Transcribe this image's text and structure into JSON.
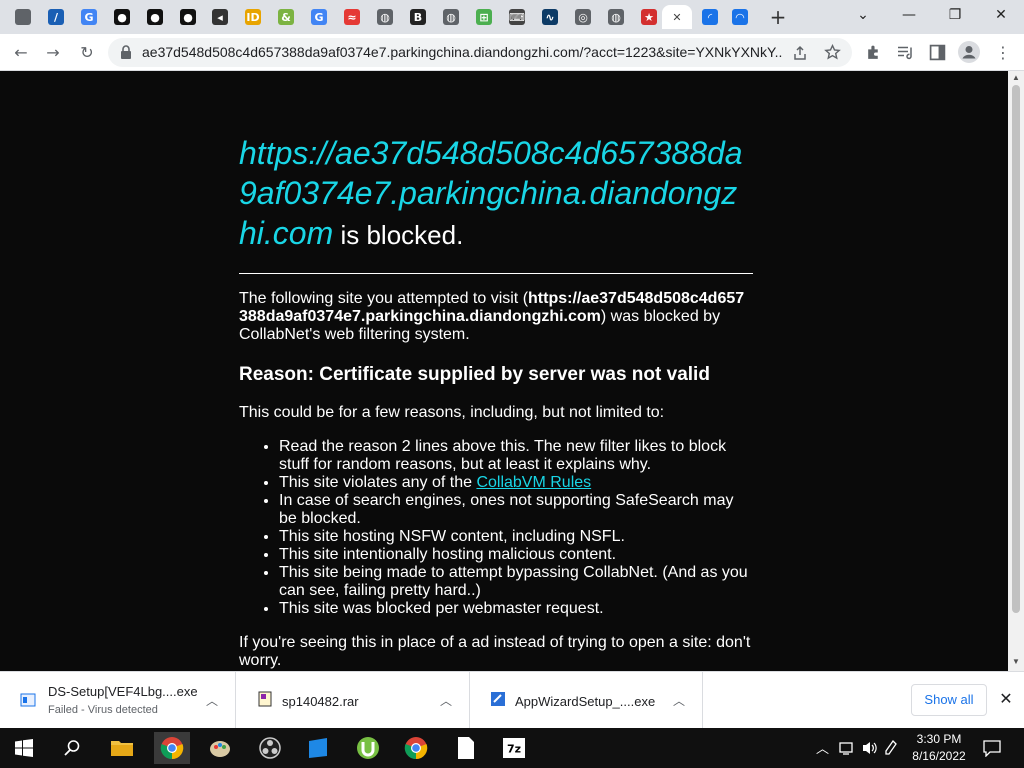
{
  "tabs": [
    {
      "icon": "gray-cube-icon",
      "glyph": "",
      "color": "#5f6368"
    },
    {
      "icon": "blue-slash-icon",
      "glyph": "/",
      "color": "#1a5fb4"
    },
    {
      "icon": "google-icon",
      "glyph": "G",
      "color": "#4285f4"
    },
    {
      "icon": "github-icon",
      "glyph": "●",
      "color": "#111"
    },
    {
      "icon": "github-icon",
      "glyph": "●",
      "color": "#111"
    },
    {
      "icon": "github-icon",
      "glyph": "●",
      "color": "#111"
    },
    {
      "icon": "speaker-icon",
      "glyph": "◂",
      "color": "#333"
    },
    {
      "icon": "yellow-id-icon",
      "glyph": "ID",
      "color": "#e8a400"
    },
    {
      "icon": "green-ampersand-icon",
      "glyph": "&",
      "color": "#7cb342"
    },
    {
      "icon": "google-icon",
      "glyph": "G",
      "color": "#4285f4"
    },
    {
      "icon": "rainbow-icon",
      "glyph": "≈",
      "color": "#e53935"
    },
    {
      "icon": "globe-icon",
      "glyph": "◍",
      "color": "#5f6368"
    },
    {
      "icon": "b-box-icon",
      "glyph": "B",
      "color": "#222"
    },
    {
      "icon": "globe-icon",
      "glyph": "◍",
      "color": "#5f6368"
    },
    {
      "icon": "windows-icon",
      "glyph": "⊞",
      "color": "#4caf50"
    },
    {
      "icon": "keyboard-icon",
      "glyph": "⌨",
      "color": "#444"
    },
    {
      "icon": "stock-chart-icon",
      "glyph": "∿",
      "color": "#0d3b66"
    },
    {
      "icon": "chrome-icon",
      "glyph": "◎",
      "color": "#5f6368"
    },
    {
      "icon": "globe-icon",
      "glyph": "◍",
      "color": "#5f6368"
    },
    {
      "icon": "red-star-icon",
      "glyph": "★",
      "color": "#d32f2f"
    },
    {
      "icon": "close-icon",
      "glyph": "✕",
      "color": "#ffffff",
      "active": true
    },
    {
      "icon": "loading-spinner-icon",
      "glyph": "◜",
      "color": "#1a73e8"
    },
    {
      "icon": "loading-spinner-icon",
      "glyph": "◠",
      "color": "#1a73e8"
    }
  ],
  "new_tab_label": "+",
  "window": {
    "minimize": "—",
    "restore": "❐",
    "close": "✕",
    "tab_search": "⌄"
  },
  "toolbar": {
    "url": "ae37d548d508c4d657388da9af0374e7.parkingchina.diandongzhi.com/?acct=1223&site=YXNkYXNkY...",
    "back": "←",
    "forward": "→",
    "reload": "↻"
  },
  "page": {
    "blocked_url": "https://ae37d548d508c4d657388da9af0374e7.parkingchina.diandongzhi.com",
    "blocked_suffix": " is blocked.",
    "intro_prefix": "The following site you attempted to visit (",
    "intro_host": "https://ae37d548d508c4d657388da9af0374e7.parkingchina.diandongzhi.com",
    "intro_suffix": ") was blocked by CollabNet's web filtering system.",
    "reason": "Reason: Certificate supplied by server was not valid",
    "lead": "This could be for a few reasons, including, but not limited to:",
    "reasons": [
      "Read the reason 2 lines above this. The new filter likes to block stuff for random reasons, but at least it explains why.",
      "This site violates any of the ",
      "In case of search engines, ones not supporting SafeSearch may be blocked.",
      "This site hosting NSFW content, including NSFL.",
      "This site intentionally hosting malicious content.",
      "This site being made to attempt bypassing CollabNet. (And as you can see, failing pretty hard..)",
      "This site was blocked per webmaster request."
    ],
    "rules_link": "CollabVM Rules",
    "footer": "If you're seeing this in place of a ad instead of trying to open a site: don't worry."
  },
  "downloads": [
    {
      "name": "DS-Setup[VEF4Lbg....exe",
      "status": "Failed - Virus detected"
    },
    {
      "name": "sp140482.rar",
      "status": ""
    },
    {
      "name": "AppWizardSetup_....exe",
      "status": ""
    }
  ],
  "show_all": "Show all",
  "taskbar": {
    "time": "3:30 PM",
    "date": "8/16/2022"
  }
}
